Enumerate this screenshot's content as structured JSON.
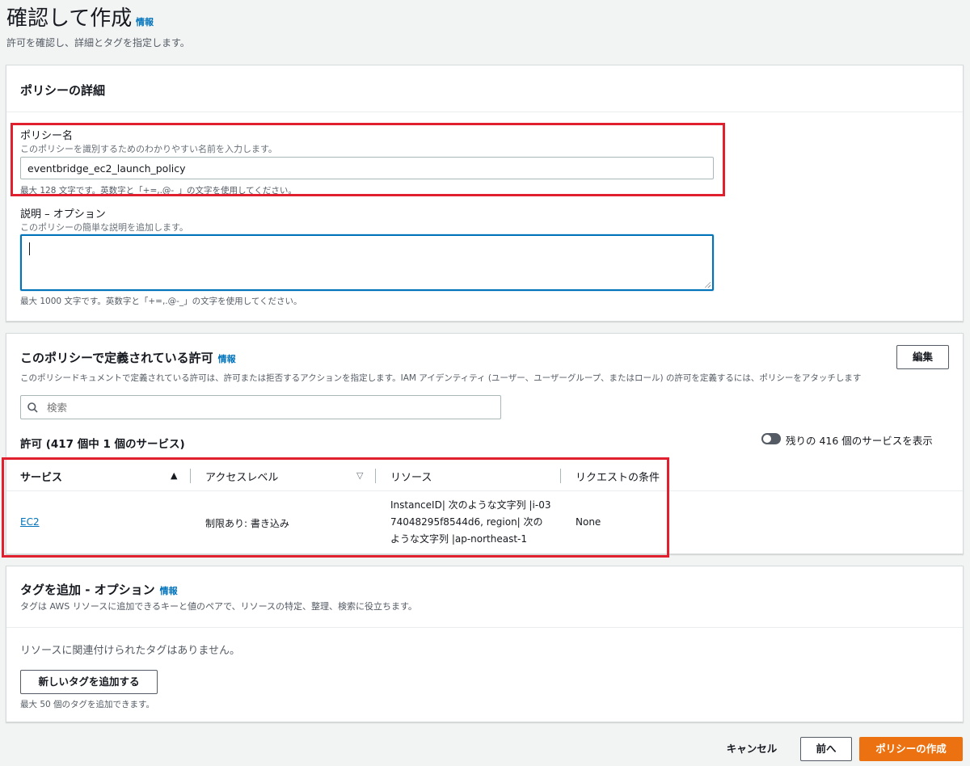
{
  "header": {
    "title": "確認して作成",
    "info_link": "情報",
    "subtitle": "許可を確認し、詳細とタグを指定します。"
  },
  "policy_details": {
    "heading": "ポリシーの詳細",
    "name_label": "ポリシー名",
    "name_desc": "このポリシーを識別するためのわかりやすい名前を入力します。",
    "name_value": "eventbridge_ec2_launch_policy",
    "name_hint": "最大 128 文字です。英数字と「+=,.@-_」の文字を使用してください。",
    "desc_label": "説明 – オプション",
    "desc_desc": "このポリシーの簡単な説明を追加します。",
    "desc_value": "",
    "desc_hint": "最大 1000 文字です。英数字と「+=,.@-_」の文字を使用してください。"
  },
  "permissions": {
    "heading": "このポリシーで定義されている許可",
    "info_link": "情報",
    "edit_button": "編集",
    "description": "このポリシードキュメントで定義されている許可は、許可または拒否するアクションを指定します。IAM アイデンティティ (ユーザー、ユーザーグループ、またはロール) の許可を定義するには、ポリシーをアタッチします",
    "search_placeholder": "検索",
    "count_label": "許可 (417 個中 1 個のサービス)",
    "toggle_label": "残りの 416 個のサービスを表示",
    "toggle_on": false,
    "columns": [
      "サービス",
      "アクセスレベル",
      "リソース",
      "リクエストの条件"
    ],
    "rows": [
      {
        "service": "EC2",
        "access_level": "制限あり: 書き込み",
        "resource": "InstanceID| 次のような文字列 |i-0374048295f8544d6, region| 次のような文字列 |ap-northeast-1",
        "condition": "None"
      }
    ]
  },
  "tags": {
    "heading": "タグを追加 - オプション",
    "info_link": "情報",
    "description": "タグは AWS リソースに追加できるキーと値のペアで、リソースの特定、整理、検索に役立ちます。",
    "empty_text": "リソースに関連付けられたタグはありません。",
    "add_button": "新しいタグを追加する",
    "hint": "最大 50 個のタグを追加できます。"
  },
  "footer": {
    "cancel": "キャンセル",
    "previous": "前へ",
    "create": "ポリシーの作成"
  },
  "colors": {
    "primary_button": "#ec7211",
    "link": "#0073bb",
    "highlight_box": "#e0202f"
  }
}
